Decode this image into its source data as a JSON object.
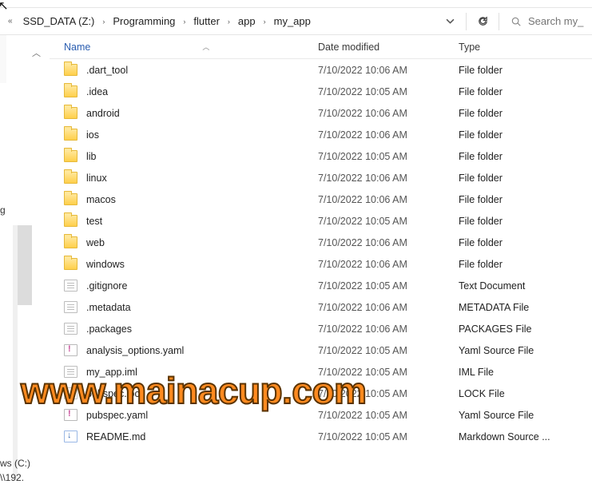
{
  "breadcrumb": {
    "items": [
      {
        "label": "SSD_DATA (Z:)"
      },
      {
        "label": "Programming"
      },
      {
        "label": "flutter"
      },
      {
        "label": "app"
      },
      {
        "label": "my_app"
      }
    ]
  },
  "search": {
    "placeholder": "Search my_"
  },
  "columns": {
    "name": "Name",
    "date": "Date modified",
    "type": "Type"
  },
  "files": [
    {
      "icon": "folder",
      "name": ".dart_tool",
      "date": "7/10/2022 10:06 AM",
      "type": "File folder"
    },
    {
      "icon": "folder",
      "name": ".idea",
      "date": "7/10/2022 10:05 AM",
      "type": "File folder"
    },
    {
      "icon": "folder",
      "name": "android",
      "date": "7/10/2022 10:06 AM",
      "type": "File folder"
    },
    {
      "icon": "folder",
      "name": "ios",
      "date": "7/10/2022 10:06 AM",
      "type": "File folder"
    },
    {
      "icon": "folder",
      "name": "lib",
      "date": "7/10/2022 10:05 AM",
      "type": "File folder"
    },
    {
      "icon": "folder",
      "name": "linux",
      "date": "7/10/2022 10:06 AM",
      "type": "File folder"
    },
    {
      "icon": "folder",
      "name": "macos",
      "date": "7/10/2022 10:06 AM",
      "type": "File folder"
    },
    {
      "icon": "folder",
      "name": "test",
      "date": "7/10/2022 10:05 AM",
      "type": "File folder"
    },
    {
      "icon": "folder",
      "name": "web",
      "date": "7/10/2022 10:06 AM",
      "type": "File folder"
    },
    {
      "icon": "folder",
      "name": "windows",
      "date": "7/10/2022 10:06 AM",
      "type": "File folder"
    },
    {
      "icon": "text",
      "name": ".gitignore",
      "date": "7/10/2022 10:05 AM",
      "type": "Text Document"
    },
    {
      "icon": "text",
      "name": ".metadata",
      "date": "7/10/2022 10:06 AM",
      "type": "METADATA File"
    },
    {
      "icon": "text",
      "name": ".packages",
      "date": "7/10/2022 10:06 AM",
      "type": "PACKAGES File"
    },
    {
      "icon": "yaml",
      "name": "analysis_options.yaml",
      "date": "7/10/2022 10:05 AM",
      "type": "Yaml Source File"
    },
    {
      "icon": "text",
      "name": "my_app.iml",
      "date": "7/10/2022 10:05 AM",
      "type": "IML File"
    },
    {
      "icon": "lock",
      "name": "pubspec.lock",
      "date": "7/10/2022 10:05 AM",
      "type": "LOCK File"
    },
    {
      "icon": "yaml",
      "name": "pubspec.yaml",
      "date": "7/10/2022 10:05 AM",
      "type": "Yaml Source File"
    },
    {
      "icon": "md",
      "name": "README.md",
      "date": "7/10/2022 10:05 AM",
      "type": "Markdown Source ..."
    }
  ],
  "sidebar": {
    "fragment1": "g",
    "drive": "ws (C:)",
    "path": "\\\\192."
  },
  "watermark": "www.mainacup.com"
}
